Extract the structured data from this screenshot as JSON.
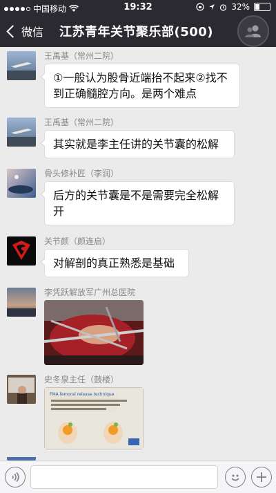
{
  "status": {
    "carrier": "中国移动",
    "time": "19:32",
    "battery": "32%",
    "battery_level": 0.32
  },
  "nav": {
    "back_label": "微信",
    "title": "江苏青年关节聚乐部(500)",
    "group_icon": "group-people-icon"
  },
  "messages": [
    {
      "sender": "王禹基（常州二院）",
      "text": "①一般认为股骨近端抬不起来②找不到正确髓腔方向。是两个难点"
    },
    {
      "sender": "王禹基（常州二院）",
      "text": "其实就是李主任讲的关节囊的松解"
    },
    {
      "sender": "骨头修补匠（李润）",
      "text": "后方的关节囊是不是需要完全松解开"
    },
    {
      "sender": "关节颜（颜连启）",
      "text": "对解剖的真正熟悉是基础"
    },
    {
      "sender": "李凭跃解放军广州总医院",
      "image": "surgery-photo"
    },
    {
      "sender": "史冬泉主任（鼓楼）",
      "image": "presentation-slide",
      "slide_title": "FMA femoral release technique"
    }
  ],
  "inputbar": {
    "voice_icon": "voice-icon",
    "emoji_icon": "emoji-icon",
    "plus_icon": "plus-icon"
  }
}
